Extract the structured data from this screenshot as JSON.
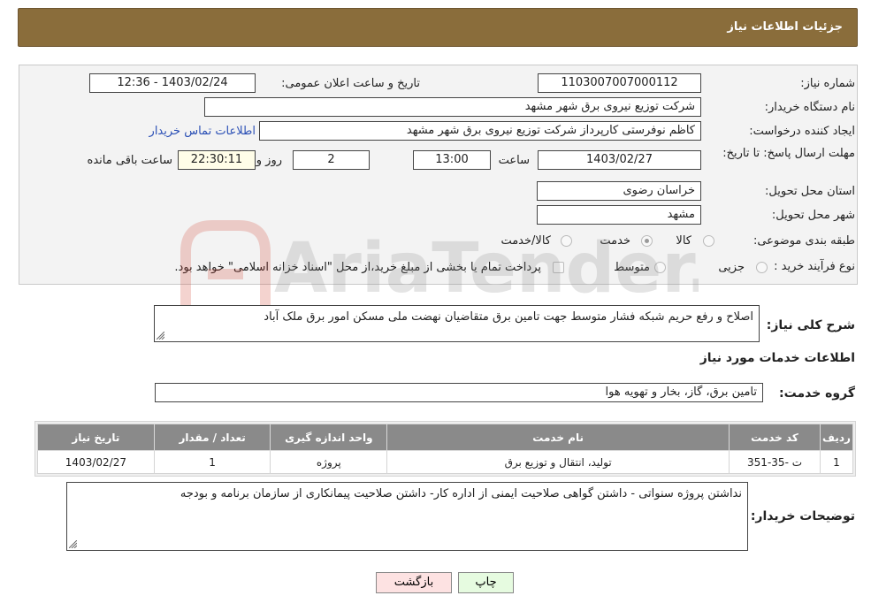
{
  "header": {
    "title": "جزئیات اطلاعات نیاز"
  },
  "form": {
    "need_number_label": "شماره نیاز:",
    "need_number": "1103007007000112",
    "announce_label": "تاریخ و ساعت اعلان عمومی:",
    "announce_value": "1403/02/24 - 12:36",
    "buyer_org_label": "نام دستگاه خریدار:",
    "buyer_org": "شرکت توزیع نیروی برق شهر مشهد",
    "creator_label": "ایجاد کننده درخواست:",
    "creator": "کاظم نوفرستی کارپرداز شرکت توزیع نیروی برق شهر مشهد",
    "contact_link": "اطلاعات تماس خریدار",
    "deadline_label": "مهلت ارسال پاسخ: تا تاریخ:",
    "deadline_date": "1403/02/27",
    "time_label": "ساعت",
    "deadline_time": "13:00",
    "days_value": "2",
    "days_label": "روز و",
    "remaining_time": "22:30:11",
    "remaining_label": "ساعت باقی مانده",
    "province_label": "استان محل تحویل:",
    "province": "خراسان رضوی",
    "city_label": "شهر محل تحویل:",
    "city": "مشهد",
    "category_label": "طبقه بندی موضوعی:",
    "category_options": [
      "کالا",
      "خدمت",
      "کالا/خدمت"
    ],
    "category_selected": "خدمت",
    "purchase_type_label": "نوع فرآیند خرید :",
    "purchase_options": [
      "جزیی",
      "متوسط"
    ],
    "purchase_note": "پرداخت تمام یا بخشی از مبلغ خرید،از محل \"اسناد خزانه اسلامی\" خواهد بود."
  },
  "description": {
    "label": "شرح کلی نیاز:",
    "value": "اصلاح و رفع حریم شبکه فشار متوسط  جهت تامین برق متقاضیان نهضت ملی مسکن امور برق ملک آباد"
  },
  "services_heading": "اطلاعات خدمات مورد نیاز",
  "service_group": {
    "label": "گروه خدمت:",
    "value": "تامین برق، گاز، بخار و تهویه هوا"
  },
  "table": {
    "headers": [
      "ردیف",
      "کد خدمت",
      "نام خدمت",
      "واحد اندازه گیری",
      "تعداد / مقدار",
      "تاریخ نیاز"
    ],
    "rows": [
      [
        "1",
        "ت -35-351",
        "تولید، انتقال و توزیع برق",
        "پروژه",
        "1",
        "1403/02/27"
      ]
    ]
  },
  "buyer_notes": {
    "label": "توضیحات خریدار:",
    "value": "نداشتن پروژه سنواتی - داشتن گواهی صلاحیت ایمنی از اداره کار- داشتن صلاحیت پیمانکاری از سازمان برنامه و بودجه"
  },
  "buttons": {
    "print": "چاپ",
    "back": "بازگشت"
  },
  "watermark_text": "AriaTender.neT",
  "colors": {
    "header_bg": "#8a6d3b",
    "table_header_bg": "#8a8a8a",
    "link": "#2a4fb5",
    "print_btn": "#e6fbe0",
    "back_btn": "#fde2e2"
  }
}
